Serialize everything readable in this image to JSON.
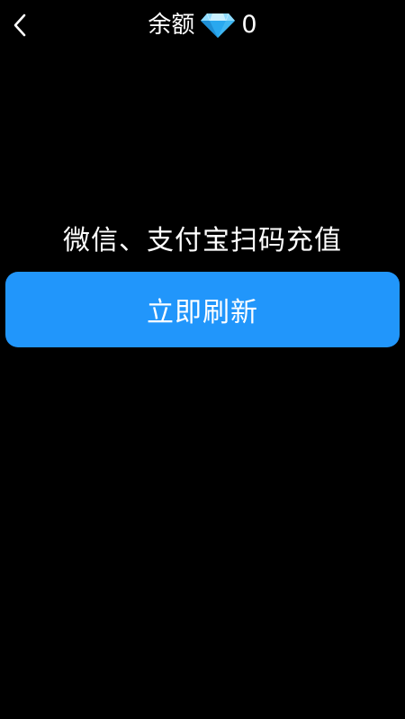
{
  "header": {
    "title": "余额",
    "balance": "0",
    "currency_icon": "diamond-icon",
    "back_icon": "chevron-left-icon"
  },
  "main": {
    "hint": "微信、支付宝扫码充值",
    "refresh_label": "立即刷新"
  },
  "colors": {
    "background": "#000000",
    "button": "#2196fb",
    "text": "#ffffff"
  }
}
